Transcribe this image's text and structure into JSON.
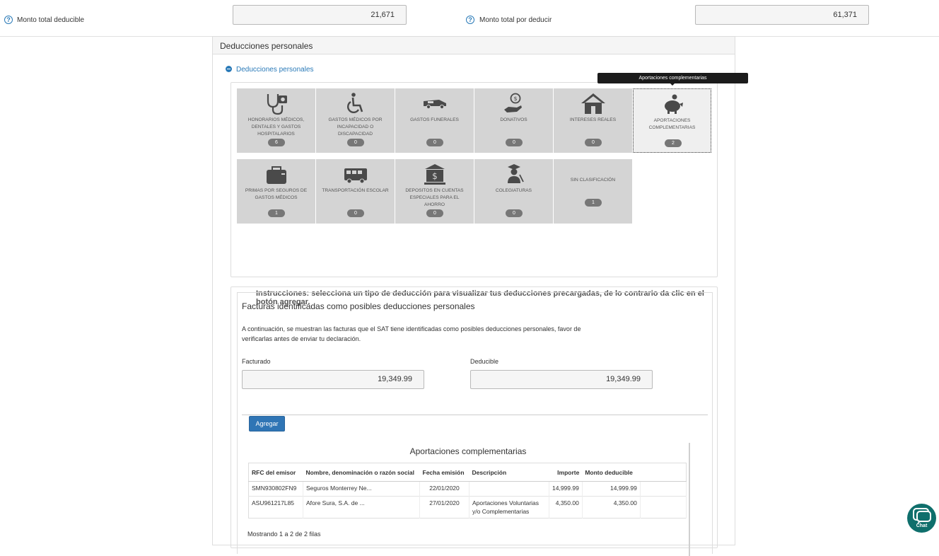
{
  "summary": {
    "total_deductible_label": "Monto total deducible",
    "total_deductible_value": "21,671",
    "to_deduct_label": "Monto total por deducir",
    "to_deduct_value": "61,371"
  },
  "panel": {
    "title": "Deducciones personales",
    "collapse_label": "Deducciones personales"
  },
  "tooltip": "Aportaciones complementarias",
  "categories": [
    {
      "label": "Honorarios médicos, dentales y gastos hospitalarios",
      "count": "6",
      "icon": "stethoscope-icon"
    },
    {
      "label": "Gastos médicos por incapacidad o discapacidad",
      "count": "0",
      "icon": "wheelchair-icon"
    },
    {
      "label": "Gastos funerales",
      "count": "0",
      "icon": "hearse-icon"
    },
    {
      "label": "Donativos",
      "count": "0",
      "icon": "donation-hand-icon"
    },
    {
      "label": "Intereses reales",
      "count": "0",
      "icon": "house-icon"
    },
    {
      "label": "Aportaciones complementarias",
      "count": "2",
      "icon": "piggy-bank-icon"
    },
    {
      "label": "Primas por seguros de gastos médicos",
      "count": "1",
      "icon": "medical-bag-icon"
    },
    {
      "label": "Transportación escolar",
      "count": "0",
      "icon": "school-bus-icon"
    },
    {
      "label": "Depositos en cuentas especiales para el ahorro",
      "count": "0",
      "icon": "bank-icon"
    },
    {
      "label": "Colegiaturas",
      "count": "0",
      "icon": "graduate-icon"
    },
    {
      "label": "Sin clasificación",
      "count": "1",
      "icon": ""
    }
  ],
  "instructions": "Instrucciones: selecciona un tipo de deducción para visualizar tus deducciones precargadas, de lo contrario da clic en el botón agregar.",
  "invoices": {
    "title": "Facturas identificadas como posibles deducciones personales",
    "description": "A continuación, se muestran las facturas que el SAT tiene identificadas como posibles deducciones personales, favor de verificarlas antes de enviar tu declaración.",
    "billed_label": "Facturado",
    "billed_value": "19,349.99",
    "deductible_label": "Deducible",
    "deductible_value": "19,349.99",
    "add_button": "Agregar",
    "table_title": "Aportaciones complementarias",
    "columns": [
      "RFC del emisor",
      "Nombre, denominación o razón social",
      "Fecha emisión",
      "Descripción",
      "Importe",
      "Monto deducible"
    ],
    "rows": [
      {
        "rfc": "SMN930802FN9",
        "name": "Seguros Monterrey Ne...",
        "date": "22/01/2020",
        "desc": "",
        "amount": "14,999.99",
        "deductible": "14,999.99"
      },
      {
        "rfc": "ASU961217L85",
        "name": "Afore Sura, S.A. de ...",
        "date": "27/01/2020",
        "desc": "Aportaciones Voluntarias y/o Complementarias",
        "amount": "4,350.00",
        "deductible": "4,350.00"
      }
    ],
    "showing": "Mostrando 1 a 2 de 2 filas"
  },
  "chat_label": "Chat",
  "colors": {
    "accent": "#2f75b5",
    "link": "#2a7ab8",
    "tile_bg": "#d4d4d4",
    "chat": "#0f6f6c"
  }
}
